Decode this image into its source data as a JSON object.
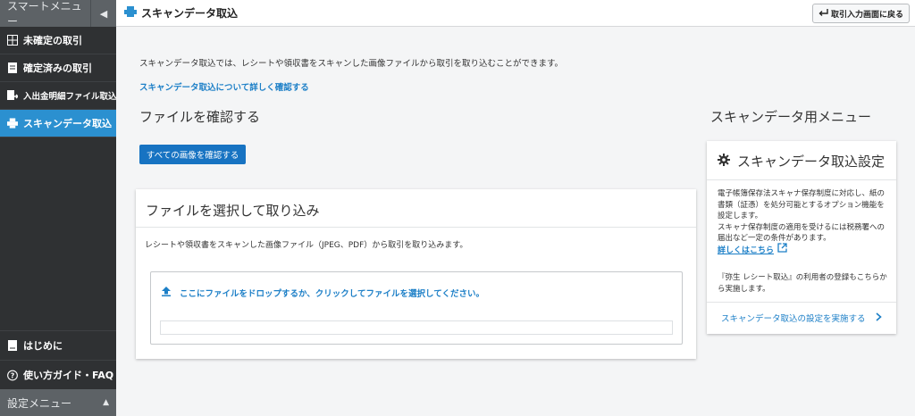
{
  "sidebar": {
    "header": "スマートメニュー",
    "collapse_icon": "chevron-left-icon",
    "items": [
      {
        "label": "未確定の取引",
        "icon": "grid-icon"
      },
      {
        "label": "確定済みの取引",
        "icon": "document-icon"
      },
      {
        "label": "入出金明細ファイル取込",
        "icon": "file-import-icon"
      },
      {
        "label": "スキャンデータ取込",
        "icon": "scanner-icon",
        "active": true
      }
    ],
    "bottom_items": [
      {
        "label": "はじめに",
        "icon": "book-icon"
      },
      {
        "label": "使い方ガイド・FAQ",
        "icon": "help-circle-icon"
      }
    ],
    "footer": "設定メニュー",
    "footer_icon": "chevron-up-icon"
  },
  "topbar": {
    "title": "スキャンデータ取込",
    "back_button": "取引入力画面に戻る"
  },
  "main": {
    "intro": "スキャンデータ取込では、レシートや領収書をスキャンした画像ファイルから取引を取り込むことができます。",
    "intro_link": "スキャンデータ取込について詳しく確認する",
    "section_title": "ファイルを確認する",
    "confirm_button": "すべての画像を確認する",
    "upload_card": {
      "title": "ファイルを選択して取り込み",
      "description": "レシートや領収書をスキャンした画像ファイル（JPEG、PDF）から取引を取り込みます。",
      "drop_text": "ここにファイルをドロップするか、クリックしてファイルを選択してください。"
    }
  },
  "right_panel": {
    "title": "スキャンデータ用メニュー",
    "card_title": "スキャンデータ取込設定",
    "body_line1": "電子帳簿保存法スキャナ保存制度に対応し、紙の書類（証憑）を処分可能とするオプション機能を設定します。",
    "body_line2": "スキャナ保存制度の適用を受けるには税務署への届出など一定の条件があります。",
    "details_link": "詳しくはこちら",
    "note": "『弥生 レシート取込』の利用者の登録もこちらから実施します。",
    "action": "スキャンデータ取込の設定を実施する"
  },
  "colors": {
    "sidebar_bg": "#2f3133",
    "active_item": "#2b90d0",
    "primary_button": "#1773c2",
    "link": "#1c7fc7"
  }
}
